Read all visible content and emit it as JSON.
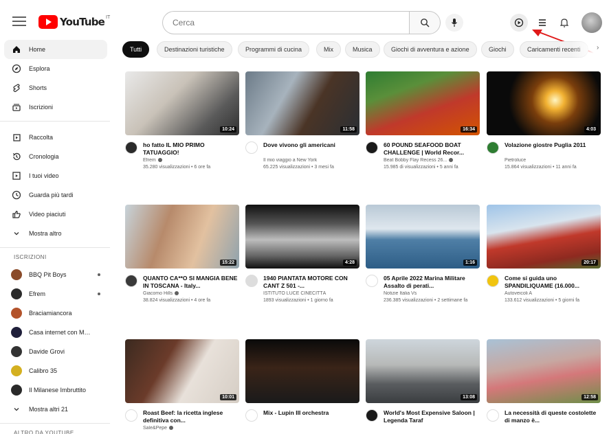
{
  "header": {
    "logo_text": "YouTube",
    "logo_sup": "IT",
    "search_placeholder": "Cerca"
  },
  "sidebar": {
    "main": [
      {
        "label": "Home",
        "icon": "home-icon",
        "active": true
      },
      {
        "label": "Esplora",
        "icon": "compass-icon"
      },
      {
        "label": "Shorts",
        "icon": "shorts-icon"
      },
      {
        "label": "Iscrizioni",
        "icon": "subscriptions-icon"
      }
    ],
    "library": [
      {
        "label": "Raccolta",
        "icon": "library-icon"
      },
      {
        "label": "Cronologia",
        "icon": "history-icon"
      },
      {
        "label": "I tuoi video",
        "icon": "your-videos-icon"
      },
      {
        "label": "Guarda più tardi",
        "icon": "watch-later-icon"
      },
      {
        "label": "Video piaciuti",
        "icon": "liked-icon"
      },
      {
        "label": "Mostra altro",
        "icon": "chevron-down-icon"
      }
    ],
    "subscriptions_title": "ISCRIZIONI",
    "subscriptions": [
      {
        "label": "BBQ Pit Boys",
        "color": "#8a4b2a",
        "dot": true
      },
      {
        "label": "Efrem",
        "color": "#2b2b2b",
        "dot": true
      },
      {
        "label": "Braciamiancora",
        "color": "#b3532b"
      },
      {
        "label": "Casa internet con Mat...",
        "color": "#1f1f3a"
      },
      {
        "label": "Davide Grovi",
        "color": "#333333"
      },
      {
        "label": "Calibro 35",
        "color": "#d4b020"
      },
      {
        "label": "Il Milanese Imbruttito",
        "color": "#2a2a2a"
      },
      {
        "label": "Mostra altri 21",
        "icon": "chevron-down-icon"
      }
    ],
    "more_title": "ALTRO DA YOUTUBE"
  },
  "chips": [
    "Tutti",
    "Destinazioni turistiche",
    "Programmi di cucina",
    "Mix",
    "Musica",
    "Giochi di avventura e azione",
    "Giochi",
    "Caricamenti recenti"
  ],
  "videos": [
    {
      "title": "ho fatto IL MIO PRIMO TATUAGGIO!",
      "channel": "Efrem",
      "verified": true,
      "stats": "35.280 visualizzazioni • 6 ore fa",
      "duration": "10:24",
      "avatar": "#2b2b2b",
      "thumb": "linear-gradient(135deg,#e9e9e9 0%,#c9c2b8 40%,#5a5a5a 75%,#2f2f2f 100%)"
    },
    {
      "title": "Dove vivono gli americani",
      "channel": "Il mio viaggio a New York",
      "stats": "65.225 visualizzazioni • 3 mesi fa",
      "duration": "11:58",
      "avatar": "#ffffff",
      "thumb": "linear-gradient(120deg,#6c7b88 0%,#a7b3bd 35%,#4a3426 60%,#2a2f34 100%)"
    },
    {
      "title": "60 POUND SEAFOOD BOAT CHALLENGE | World Recor...",
      "channel": "Beat Bobby Flay Recess 26...",
      "verified": true,
      "stats": "15.985 di visualizzazioni • 5 anni fa",
      "duration": "16:34",
      "avatar": "#1a1a1a",
      "thumb": "linear-gradient(160deg,#2e7d32 0%,#5a8f3a 30%,#c0392b 60%,#d35400 100%)"
    },
    {
      "title": "Volazione giostre Puglia 2011",
      "channel": "Pietroluce",
      "stats": "15.864 visualizzazioni • 11 anni fa",
      "duration": "4:03",
      "avatar": "#2e7d32",
      "thumb": "radial-gradient(circle at 60% 45%,#fff6c2 0,#f2b233 12%,#7a3e0c 30%,#0a0a0a 60%)"
    },
    {
      "title": "QUANTO CA**O SI MANGIA BENE IN TOSCANA - Italy...",
      "channel": "Giacomo Hills",
      "verified": true,
      "stats": "38.824 visualizzazioni • 4 ore fa",
      "duration": "15:22",
      "avatar": "#3a3a3a",
      "thumb": "linear-gradient(110deg,#c7d3da 0%,#b78a6b 35%,#e2c1a0 65%,#8fa2ad 100%)"
    },
    {
      "title": "1940 PIANTATA MOTORE CON CANT Z 501 -...",
      "channel": "ISTITUTO LUCE CINECITTÀ",
      "stats": "1893 visualizzazioni • 1 giorno fa",
      "duration": "4:28",
      "avatar": "#dddddd",
      "thumb": "linear-gradient(180deg,#111 0%,#555 30%,#bdbdbd 55%,#666 80%,#111 100%)"
    },
    {
      "title": "05 Aprile 2022 Marina Militare Assalto di perati...",
      "channel": "Notizie Italia Vs",
      "stats": "236.385 visualizzazioni • 2 settimane fa",
      "duration": "1:16",
      "avatar": "#ffffff",
      "thumb": "linear-gradient(180deg,#b9c9d6 0%,#dfe7ee 38%,#4f7fa6 55%,#2d5d86 100%)"
    },
    {
      "title": "Come si guida uno SPANDILIQUAME (16.000...",
      "channel": "Autoveicoli A",
      "stats": "133.612 visualizzazioni • 5 giorni fa",
      "duration": "20:17",
      "avatar": "#f1c40f",
      "thumb": "linear-gradient(170deg,#9fc4e8 0%,#d8e4ee 35%,#c0392b 55%,#8e2a20 80%,#556b2f 100%)"
    },
    {
      "title": "Roast Beef: la ricetta inglese definitiva con...",
      "channel": "Sale&Pepe",
      "verified": true,
      "stats": "",
      "duration": "10:01",
      "avatar": "#ffffff",
      "thumb": "linear-gradient(120deg,#3b2a20 0%,#6b3b2a 35%,#e8e1da 60%,#d5cdc4 100%)"
    },
    {
      "title": "Mix - Lupin III orchestra",
      "channel": "",
      "stats": "",
      "duration": "",
      "avatar": "#ffffff",
      "thumb": "linear-gradient(180deg,#0a0a0a 0%,#3a2418 45%,#1a1a1a 100%)"
    },
    {
      "title": "World's Most Expensive Saloon | Legenda Taraf",
      "channel": "",
      "verified": true,
      "stats": "",
      "duration": "13:08",
      "avatar": "#1a1a1a",
      "thumb": "linear-gradient(180deg,#ced6dc 0%,#b7b9b8 40%,#5a5d60 70%,#3a3d40 100%)"
    },
    {
      "title": "La necessità di queste costolette di manzo è...",
      "channel": "",
      "stats": "",
      "duration": "12:58",
      "avatar": "#ffffff",
      "thumb": "linear-gradient(170deg,#a9c2d6 0%,#c7a7a1 40%,#d4787a 60%,#6f8f4a 100%)"
    }
  ]
}
